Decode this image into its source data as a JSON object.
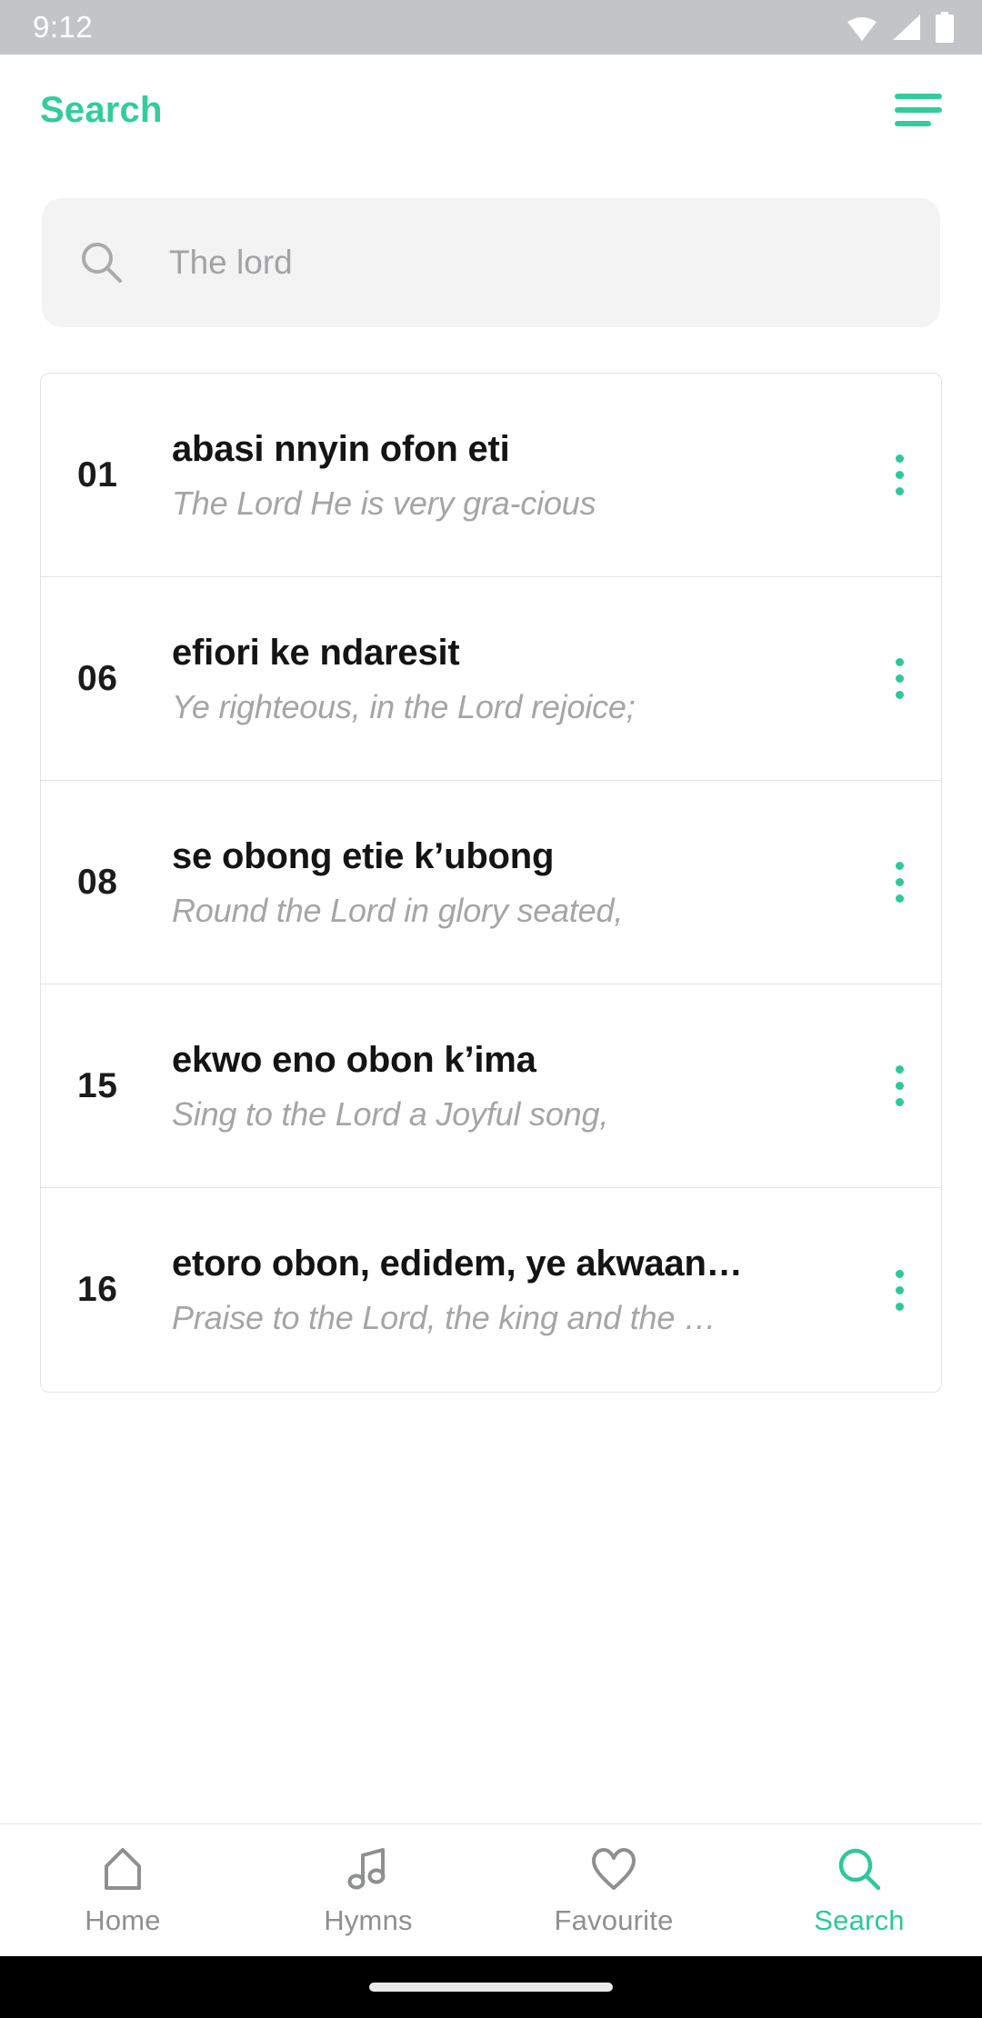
{
  "status_bar": {
    "time": "9:12",
    "icons": [
      "wifi-icon",
      "signal-icon",
      "battery-icon"
    ],
    "background_color": "#c3c4c6"
  },
  "header": {
    "title": "Search",
    "accent_color": "#32cc9d",
    "menu_icon": "hamburger-menu-icon"
  },
  "search": {
    "icon": "search-icon",
    "value": "The lord",
    "placeholder": "The lord"
  },
  "results": [
    {
      "number": "01",
      "title": "abasi nnyin ofon eti",
      "subtitle": "The Lord He is very gra-cious",
      "menu_icon": "more-vertical-icon"
    },
    {
      "number": "06",
      "title": "efiori ke ndaresit",
      "subtitle": "Ye righteous, in the Lord rejoice;",
      "menu_icon": "more-vertical-icon"
    },
    {
      "number": "08",
      "title": "se obong etie k’ubong",
      "subtitle": "Round the Lord in glory seated,",
      "menu_icon": "more-vertical-icon"
    },
    {
      "number": "15",
      "title": "ekwo eno obon k’ima",
      "subtitle": "Sing to the Lord a Joyful song,",
      "menu_icon": "more-vertical-icon"
    },
    {
      "number": "16",
      "title": "etoro obon, edidem, ye akwaan…",
      "subtitle": "Praise to the Lord, the king and the …",
      "menu_icon": "more-vertical-icon"
    }
  ],
  "bottom_nav": {
    "active": "Search",
    "active_color": "#2ec89a",
    "inactive_color": "#8e8f91",
    "items": [
      {
        "label": "Home",
        "icon": "home-icon"
      },
      {
        "label": "Hymns",
        "icon": "music-note-icon"
      },
      {
        "label": "Favourite",
        "icon": "heart-icon"
      },
      {
        "label": "Search",
        "icon": "search-icon"
      }
    ]
  }
}
